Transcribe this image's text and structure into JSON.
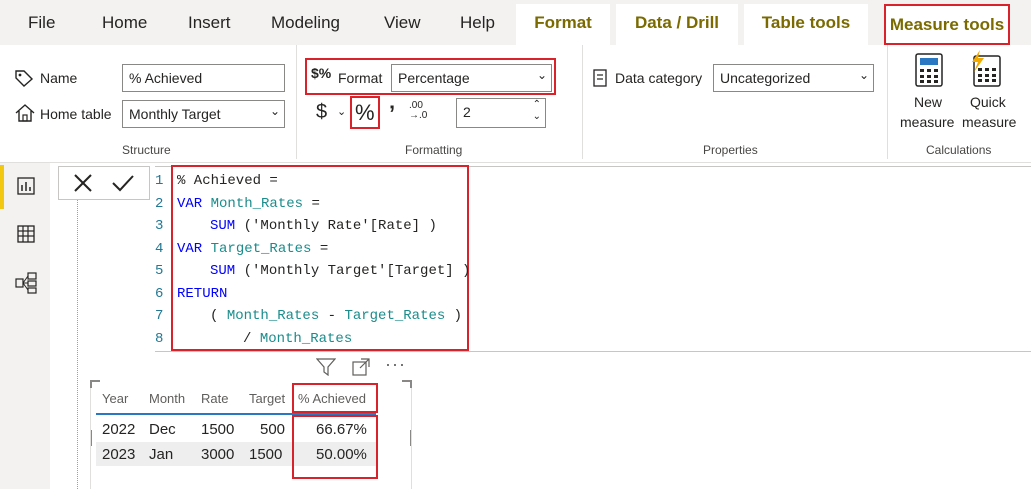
{
  "menu": {
    "file": "File",
    "home": "Home",
    "insert": "Insert",
    "modeling": "Modeling",
    "view": "View",
    "help": "Help"
  },
  "context_tabs": {
    "format": "Format",
    "data_drill": "Data / Drill",
    "table_tools": "Table tools",
    "measure_tools": "Measure tools"
  },
  "structure": {
    "name_label": "Name",
    "name_value": "% Achieved",
    "home_table_label": "Home table",
    "home_table_value": "Monthly Target",
    "group_label": "Structure"
  },
  "formatting": {
    "format_label": "Format",
    "format_value": "Percentage",
    "decimals_value": "2",
    "group_label": "Formatting"
  },
  "properties": {
    "data_category_label": "Data category",
    "data_category_value": "Uncategorized",
    "group_label": "Properties"
  },
  "calculations": {
    "new_measure_l1": "New",
    "new_measure_l2": "measure",
    "quick_measure_l1": "Quick",
    "quick_measure_l2": "measure",
    "group_label": "Calculations"
  },
  "editor": {
    "line_numbers": [
      "1",
      "2",
      "3",
      "4",
      "5",
      "6",
      "7",
      "8"
    ],
    "line1": "% Achieved =",
    "line2_kw": "VAR",
    "line2_var": "Month_Rates",
    "line2_rest": " =",
    "line3_fn": "SUM",
    "line3_rest": " ('Monthly Rate'[Rate] )",
    "line4_kw": "VAR",
    "line4_var": "Target_Rates",
    "line4_rest": " =",
    "line5_fn": "SUM",
    "line5_rest": " ('Monthly Target'[Target] )",
    "line6_kw": "RETURN",
    "line7_open": "( ",
    "line7_var1": "Month_Rates",
    "line7_mid": " - ",
    "line7_var2": "Target_Rates",
    "line7_close": " )",
    "line8_op": "/ ",
    "line8_var": "Month_Rates"
  },
  "table": {
    "headers": [
      "Year",
      "Month",
      "Rate",
      "Target",
      "% Achieved"
    ],
    "rows": [
      [
        "2022",
        "Dec",
        "1500",
        "500",
        "66.67%"
      ],
      [
        "2023",
        "Jan",
        "3000",
        "1500",
        "50.00%"
      ]
    ]
  },
  "colors": {
    "highlight_box": "#d9222a",
    "context_tab_text": "#7a6a00",
    "active_rail": "#f2c811"
  }
}
